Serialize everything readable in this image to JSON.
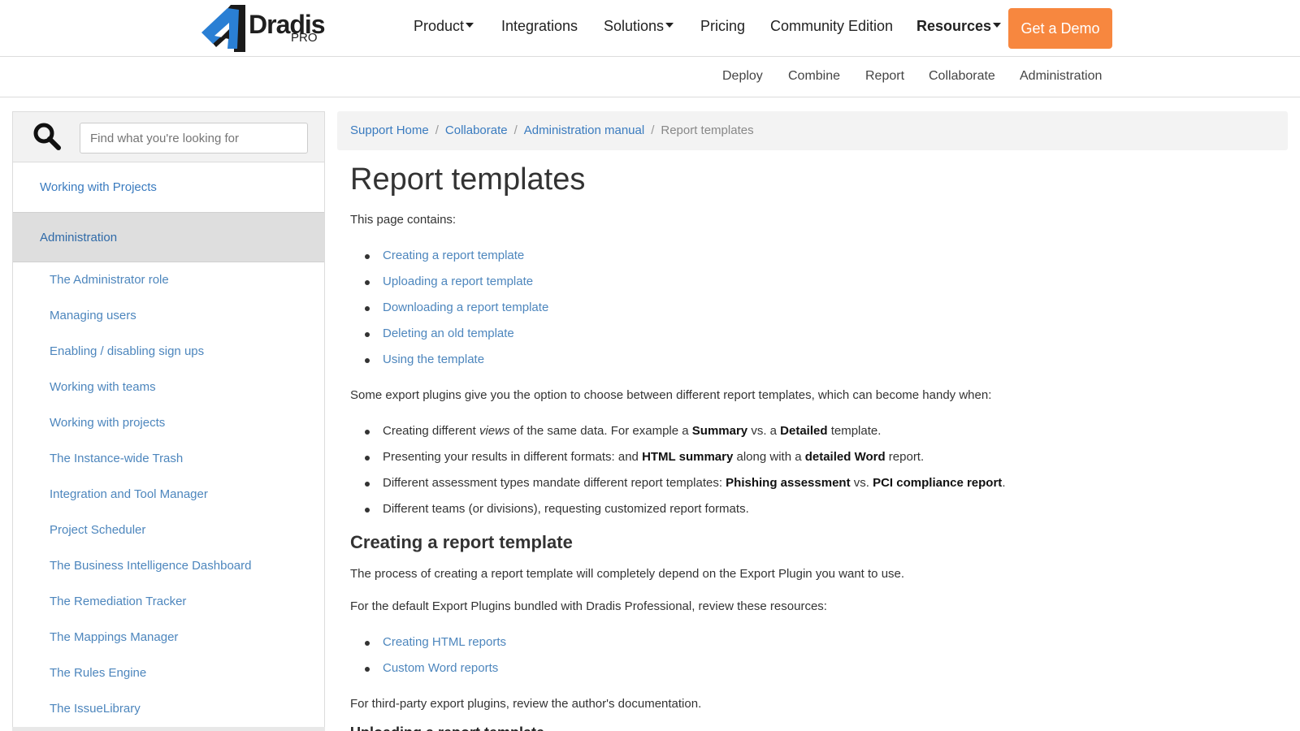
{
  "topnav": {
    "logo_word": "Dradis",
    "logo_pro": "PRO",
    "items": [
      {
        "label": "Product",
        "dropdown": true
      },
      {
        "label": "Integrations",
        "dropdown": false
      },
      {
        "label": "Solutions",
        "dropdown": true
      },
      {
        "label": "Pricing",
        "dropdown": false
      },
      {
        "label": "Community Edition",
        "dropdown": false
      },
      {
        "label": "Resources",
        "dropdown": true,
        "active": true
      }
    ],
    "demo_button": "Get a Demo",
    "demo_color": "#f7873f"
  },
  "subnav": [
    "Deploy",
    "Combine",
    "Report",
    "Collaborate",
    "Administration"
  ],
  "sidebar": {
    "search_placeholder": "Find what you're looking for",
    "search_icon": "search-icon",
    "top_items": [
      "Working with Projects",
      "Administration"
    ],
    "sub_items": [
      "The Administrator role",
      "Managing users",
      "Enabling / disabling sign ups",
      "Working with teams",
      "Working with projects",
      "The Instance-wide Trash",
      "Integration and Tool Manager",
      "Project Scheduler",
      "The Business Intelligence Dashboard",
      "The Remediation Tracker",
      "The Mappings Manager",
      "The Rules Engine",
      "The IssueLibrary"
    ]
  },
  "breadcrumb": {
    "links": [
      "Support Home",
      "Collaborate",
      "Administration manual"
    ],
    "current": "Report templates"
  },
  "content": {
    "title": "Report templates",
    "intro": "This page contains:",
    "toc": [
      "Creating a report template",
      "Uploading a report template",
      "Downloading a report template",
      "Deleting an old template",
      "Using the template"
    ],
    "para1": "Some export plugins give you the option to choose between different report templates, which can become handy when:",
    "bullets": {
      "b1": {
        "pre": "Creating different ",
        "em": "views",
        "mid": " of the same data. For example a ",
        "s1": "Summary",
        "mid2": " vs. a ",
        "s2": "Detailed",
        "post": " template."
      },
      "b2": {
        "pre": "Presenting your results in different formats: and ",
        "s1": "HTML summary",
        "mid": " along with a ",
        "s2": "detailed Word",
        "post": " report."
      },
      "b3": {
        "pre": "Different assessment types mandate different report templates: ",
        "s1": "Phishing assessment",
        "mid": " vs. ",
        "s2": "PCI compliance report",
        "post": "."
      },
      "b4": "Different teams (or divisions), requesting customized report formats."
    },
    "h2_creating": "Creating a report template",
    "para2": "The process of creating a report template will completely depend on the Export Plugin you want to use.",
    "para3": "For the default Export Plugins bundled with Dradis Professional, review these resources:",
    "resources": [
      "Creating HTML reports",
      "Custom Word reports"
    ],
    "para4": "For third-party export plugins, review the author's documentation.",
    "h3_uploading": "Uploading a report template"
  },
  "colors": {
    "link": "#4d86bd",
    "accent": "#f7873f",
    "logo_blue": "#2a7fd4"
  }
}
